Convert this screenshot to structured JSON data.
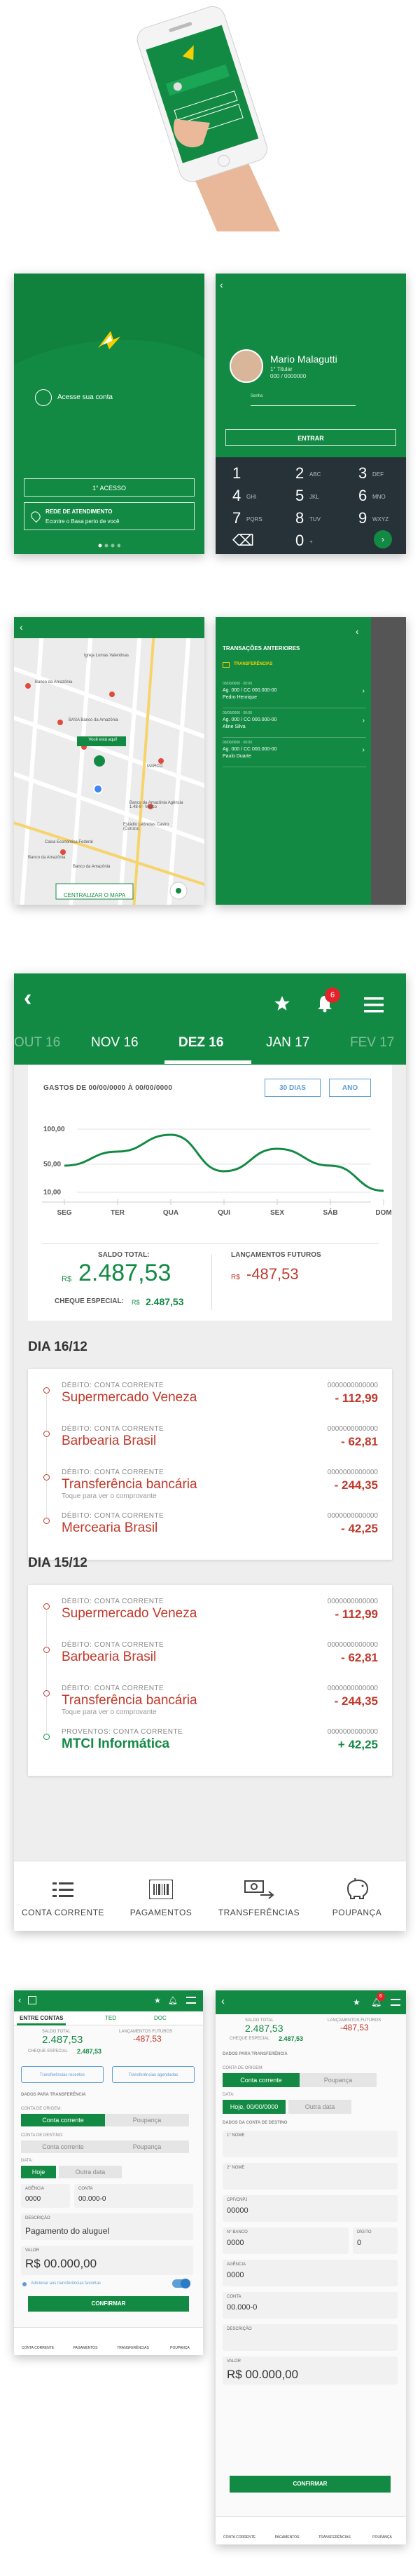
{
  "login": {
    "access_label": "Acesse sua conta",
    "first_access_button": "1° acesso",
    "service_network_title": "REDE DE ATENDIMENTO",
    "service_network_sub": "Econtre o Basa perto de você",
    "user_name": "Mario Malagutti",
    "user_role": "1° Titular",
    "user_account": "000 / 0000000",
    "password_label": "Senha",
    "enter_button": "ENTRAR",
    "keypad": [
      {
        "d": "1",
        "l": ""
      },
      {
        "d": "2",
        "l": "ABC"
      },
      {
        "d": "3",
        "l": "DEF"
      },
      {
        "d": "4",
        "l": "GHI"
      },
      {
        "d": "5",
        "l": "JKL"
      },
      {
        "d": "6",
        "l": "MNO"
      },
      {
        "d": "7",
        "l": "PQRS"
      },
      {
        "d": "8",
        "l": "TUV"
      },
      {
        "d": "9",
        "l": "WXYZ"
      },
      {
        "d": "⌫",
        "l": ""
      },
      {
        "d": "0",
        "l": "+"
      },
      {
        "d": "",
        "l": ""
      }
    ]
  },
  "map": {
    "labels": [
      "Igreja Lomas Valentinas",
      "Banco da Amazônia",
      "BASA Banco da Amazônia",
      "Você está aqui!",
      "MARCO",
      "Banco da Amazônia Agência 1.48-9 - Marco",
      "Estádio Leônidas Castro (Curuzu)",
      "Caixa Econômica Federal",
      "Banco da Amazônia",
      "Banco da Amazônia"
    ],
    "center_button": "CENTRALIZAR O MAPA"
  },
  "history": {
    "title": "TRANSAÇÕES ANTERIORES",
    "section": "TRANSFERÊNCIAS",
    "items": [
      {
        "date": "00/00/0000 · 00:00",
        "acct": "Ag. 000 / CC 000.000-00",
        "name": "Pedro Henrique"
      },
      {
        "date": "00/00/0000 · 00:00",
        "acct": "Ag. 000 / CC 000.000-00",
        "name": "Aline Silva"
      },
      {
        "date": "00/00/0000 · 00:00",
        "acct": "Ag. 000 / CC 000.000-00",
        "name": "Paulo Duarte"
      }
    ]
  },
  "statement": {
    "badge": "6",
    "months": [
      "OUT 16",
      "NOV 16",
      "DEZ 16",
      "JAN 17",
      "FEV 17"
    ],
    "period_label": "GASTOS DE 00/00/0000 À 00/00/0000",
    "btn_30": "30 DIAS",
    "btn_year": "ANO",
    "balance_label": "SALDO TOTAL:",
    "currency": "R$",
    "balance": "2.487,53",
    "special_label": "CHEQUE ESPECIAL:",
    "special_value": "2.487,53",
    "future_label": "LANÇAMENTOS FUTUROS",
    "future_value": "-487,53",
    "days": [
      {
        "title": "DIA 16/12",
        "items": [
          {
            "label": "DÉBITO: CONTA CORRENTE",
            "num": "0000000000000",
            "name": "Supermercado Veneza",
            "value": "- 112,99",
            "hint": ""
          },
          {
            "label": "DÉBITO: CONTA CORRENTE",
            "num": "0000000000000",
            "name": "Barbearia Brasil",
            "value": "- 62,81",
            "hint": ""
          },
          {
            "label": "DÉBITO: CONTA CORRENTE",
            "num": "0000000000000",
            "name": "Transferência bancária",
            "value": "- 244,35",
            "hint": "Toque para ver o comprovante"
          },
          {
            "label": "DÉBITO: CONTA CORRENTE",
            "num": "0000000000000",
            "name": "Mercearia Brasil",
            "value": "- 42,25",
            "hint": ""
          }
        ]
      },
      {
        "title": "DIA 15/12",
        "items": [
          {
            "label": "DÉBITO: CONTA CORRENTE",
            "num": "0000000000000",
            "name": "Supermercado Veneza",
            "value": "- 112,99",
            "hint": ""
          },
          {
            "label": "DÉBITO: CONTA CORRENTE",
            "num": "0000000000000",
            "name": "Barbearia Brasil",
            "value": "- 62,81",
            "hint": ""
          },
          {
            "label": "DÉBITO: CONTA CORRENTE",
            "num": "0000000000000",
            "name": "Transferência bancária",
            "value": "- 244,35",
            "hint": "Toque para ver o comprovante"
          },
          {
            "label": "PROVENTOS: CONTA CORRENTE",
            "num": "0000000000000",
            "name": "MTCI Informática",
            "value": "+ 42,25",
            "hint": ""
          }
        ]
      }
    ],
    "nav": [
      "CONTA CORRENTE",
      "PAGAMENTOS",
      "TRANSFERÊNCIAS",
      "POUPANÇA"
    ]
  },
  "chart_data": {
    "type": "line",
    "categories": [
      "SEG",
      "TER",
      "QUA",
      "QUI",
      "SEX",
      "SÁB",
      "DOM"
    ],
    "y_ticks": [
      "100,00",
      "50,00",
      "10,00"
    ],
    "values": [
      48,
      68,
      92,
      40,
      72,
      48,
      12
    ],
    "ylim": [
      0,
      120
    ],
    "title": "",
    "xlabel": "",
    "ylabel": "",
    "color": "#138a43"
  },
  "transfer_form": {
    "tabs": [
      "ENTRE CONTAS",
      "TED",
      "DOC"
    ],
    "balance_label": "SALDO TOTAL",
    "balance": "2.487,53",
    "future_label": "LANÇAMENTOS FUTUROS",
    "future": "-487,53",
    "special_label": "CHEQUE ESPECIAL",
    "special": "2.487,53",
    "btn_recent": "Transferências recentes",
    "btn_scheduled": "Transferências agendadas",
    "section": "DADOS PARA TRANSFERÊNCIA",
    "origin_label": "CONTA DE ORIGEM:",
    "dest_label": "CONTA DE DESTINO:",
    "seg_cc": "Conta corrente",
    "seg_pp": "Poupança",
    "date_label": "DATA:",
    "today": "Hoje",
    "other_date": "Outra data",
    "agency_label": "AGÊNCIA",
    "account_label": "CONTA",
    "agency_val": "0000",
    "account_val": "00.000-0",
    "desc_label": "DESCRIÇÃO",
    "desc_val": "Pagamento do aluguel",
    "value_label": "VALOR",
    "value_val": "R$ 00.000,00",
    "fav_label": "Adicionar aos transferências favoritas",
    "confirm": "CONFIRMAR"
  },
  "ted_form": {
    "badge": "6",
    "balance_label": "SALDO TOTAL",
    "balance": "2.487,53",
    "future_label": "LANÇAMENTOS FUTUROS",
    "future": "-487,53",
    "special_label": "CHEQUE ESPECIAL",
    "special": "2.487,53",
    "section": "DADOS PARA TRANSFERÊNCIA",
    "origin_label": "CONTA DE ORIGEM:",
    "seg_cc": "Conta corrente",
    "seg_pp": "Poupança",
    "date_label": "DATA:",
    "today": "Hoje, 00/00/0000",
    "other_date": "Outra data",
    "fav_section": "DADOS DA CONTA DE DESTINO",
    "fields": [
      {
        "label": "1° NOME",
        "val": ""
      },
      {
        "label": "2° NOME",
        "val": ""
      },
      {
        "label": "CPF/CNPJ",
        "val": "00000"
      },
      {
        "label": "N° BANCO",
        "val": "0000"
      },
      {
        "label": "DÍGITO",
        "val": "0"
      },
      {
        "label": "AGÊNCIA",
        "val": "0000"
      },
      {
        "label": "CONTA",
        "val": "00.000-0"
      },
      {
        "label": "DESCRIÇÃO",
        "val": ""
      },
      {
        "label": "VALOR",
        "val": "R$ 00.000,00"
      }
    ],
    "confirm": "CONFIRMAR",
    "nav": [
      "CONTA CORRENTE",
      "PAGAMENTOS",
      "TRANSFERÊNCIAS",
      "POUPANÇA"
    ]
  }
}
